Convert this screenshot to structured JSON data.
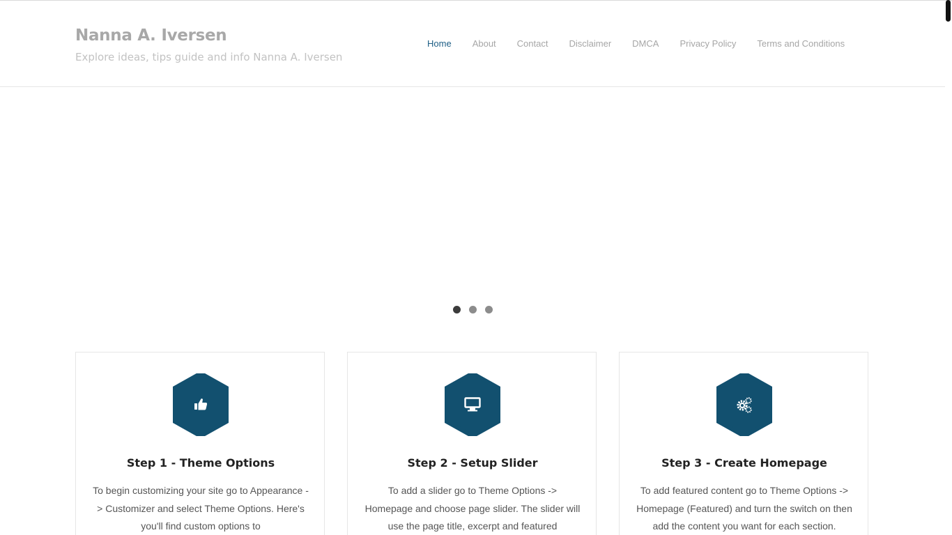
{
  "site": {
    "title": "Nanna A. Iversen",
    "tagline": "Explore ideas, tips guide and info Nanna A. Iversen"
  },
  "nav": {
    "items": [
      {
        "label": "Home",
        "active": true
      },
      {
        "label": "About"
      },
      {
        "label": "Contact"
      },
      {
        "label": "Disclaimer"
      },
      {
        "label": "DMCA"
      },
      {
        "label": "Privacy Policy"
      },
      {
        "label": "Terms and Conditions"
      }
    ]
  },
  "slider": {
    "dot_count": 3,
    "active_dot": 1
  },
  "features": [
    {
      "icon": "thumbs-up-icon",
      "title": "Step 1 - Theme Options",
      "text": "To begin customizing your site go to Appearance -> Customizer and select Theme Options. Here's you'll find custom options to"
    },
    {
      "icon": "desktop-icon",
      "title": "Step 2 - Setup Slider",
      "text": "To add a slider go to Theme Options -> Homepage and choose page slider. The slider will use the page title, excerpt and featured"
    },
    {
      "icon": "gears-icon",
      "title": "Step 3 - Create Homepage",
      "text": "To add featured content go to Theme Options -> Homepage (Featured) and turn the switch on then add the content you want for each section."
    }
  ],
  "colors": {
    "accent": "#12506f",
    "nav_active": "#1d5e85",
    "muted_text": "#a6a6a6"
  }
}
